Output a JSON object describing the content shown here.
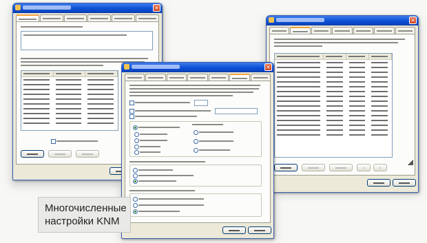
{
  "caption": {
    "line1": "Многочисленные",
    "line2": "настройки KNM"
  },
  "colors": {
    "titlebar": "#0a4fd6",
    "dialog_face": "#ece9d8",
    "active_tab_accent": "#f2a13a",
    "close_button": "#c9431e"
  },
  "window_left": {
    "buttons": [
      {
        "name": "add"
      },
      {
        "name": "edit",
        "disabled": true
      },
      {
        "name": "remove",
        "disabled": true
      }
    ],
    "list_rows": 10
  },
  "window_center": {
    "buttons": [
      {
        "name": "ok"
      },
      {
        "name": "cancel"
      }
    ],
    "radio_options": 9
  },
  "window_right": {
    "list_rows": 16,
    "buttons": [
      {
        "name": "add"
      },
      {
        "name": "edit",
        "disabled": true
      },
      {
        "name": "remove",
        "disabled": true
      },
      {
        "name": "ok"
      },
      {
        "name": "cancel"
      }
    ]
  },
  "icons": [
    "close-icon",
    "window-icon",
    "resize-grip-icon"
  ]
}
